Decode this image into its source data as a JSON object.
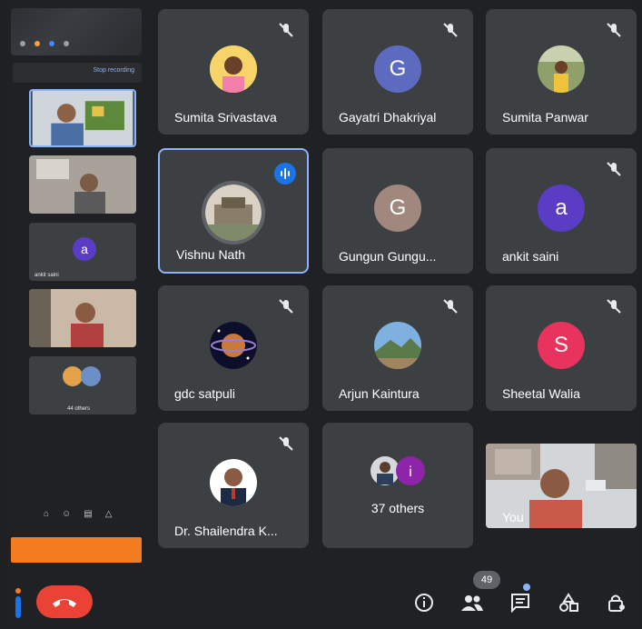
{
  "sidebar": {
    "recording_label": "Stop recording",
    "tiles": [
      {
        "label": ""
      },
      {
        "label": ""
      },
      {
        "label": "ankit saini",
        "avatar_letter": "a"
      },
      {
        "label": ""
      },
      {
        "label": "44 others"
      }
    ]
  },
  "participants": [
    {
      "name": "Sumita Srivastava",
      "muted": true
    },
    {
      "name": "Gayatri Dhakriyal",
      "avatar_letter": "G",
      "avatar_color": "#5c6bc0",
      "muted": true
    },
    {
      "name": "Sumita Panwar",
      "muted": true
    },
    {
      "name": "Vishnu Nath",
      "speaking": true
    },
    {
      "name": "Gungun Gungu...",
      "avatar_letter": "G",
      "avatar_color": "#a1887f"
    },
    {
      "name": "ankit saini",
      "avatar_letter": "a",
      "avatar_color": "#5b3cc4",
      "muted": true
    },
    {
      "name": "gdc satpuli",
      "muted": true
    },
    {
      "name": "Arjun Kaintura",
      "muted": true
    },
    {
      "name": "Sheetal Walia",
      "avatar_letter": "S",
      "avatar_color": "#e8335e",
      "muted": true
    },
    {
      "name": "Dr. Shailendra K...",
      "muted": true
    },
    {
      "name": "37 others",
      "avatar_letter": "i",
      "avatar_color": "#8e24aa"
    },
    {
      "name": "You"
    }
  ],
  "controls": {
    "participant_count": "49"
  },
  "colors": {
    "background": "#202124",
    "tile": "#3c4043",
    "accent": "#8ab4f8",
    "end_call": "#ea4335",
    "speaking": "#1a73e8"
  }
}
